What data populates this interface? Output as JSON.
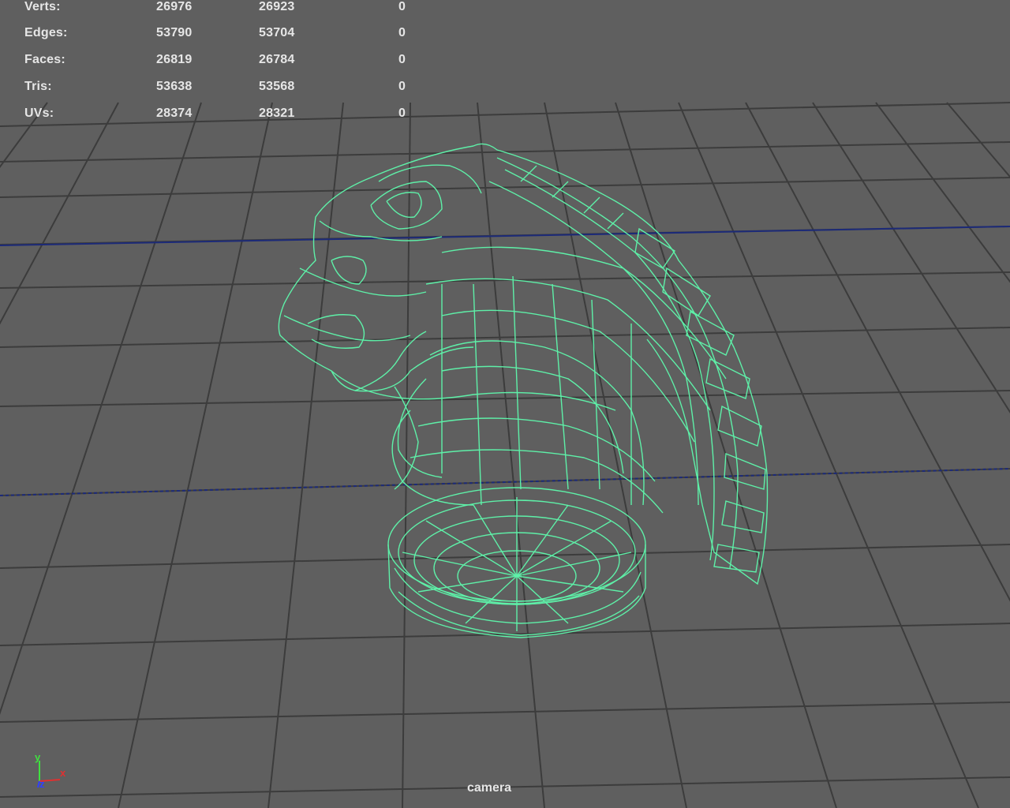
{
  "hud": {
    "rows": [
      {
        "label": "Verts:",
        "v1": "26976",
        "v2": "26923",
        "v3": "0"
      },
      {
        "label": "Edges:",
        "v1": "53790",
        "v2": "53704",
        "v3": "0"
      },
      {
        "label": "Faces:",
        "v1": "26819",
        "v2": "26784",
        "v3": "0"
      },
      {
        "label": "Tris:",
        "v1": "53638",
        "v2": "53568",
        "v3": "0"
      },
      {
        "label": "UVs:",
        "v1": "28374",
        "v2": "28321",
        "v3": "0"
      }
    ]
  },
  "viewport": {
    "camera_label": "camera",
    "axes": {
      "x": "x",
      "y": "y",
      "z": "z"
    }
  },
  "colors": {
    "background": "#5f5f5f",
    "grid": "#3a3a3a",
    "axis_line": "#1a2a7a",
    "wireframe": "#5ef0a8",
    "hud_text": "#e6e6e6",
    "axis_x": "#e03030",
    "axis_y": "#40e040",
    "axis_z": "#3040ff"
  }
}
